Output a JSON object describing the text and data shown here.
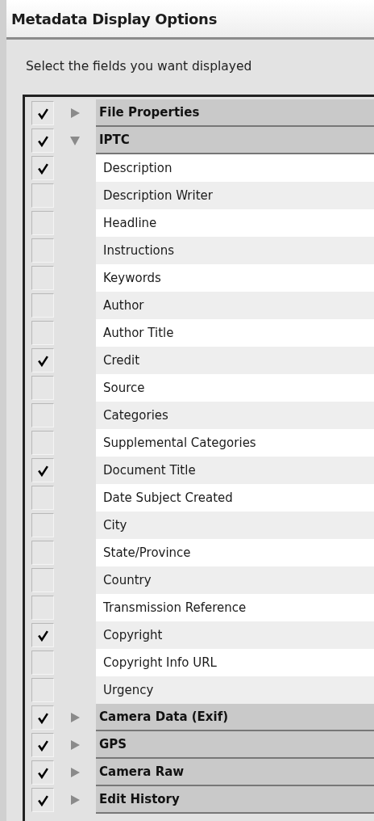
{
  "window": {
    "title": "Metadata Display Options"
  },
  "instruction": "Select the fields you want displayed",
  "groups": [
    {
      "label": "File Properties",
      "checked": true,
      "expanded": false
    },
    {
      "label": "IPTC",
      "checked": true,
      "expanded": true,
      "children": [
        {
          "label": "Description",
          "checked": true
        },
        {
          "label": "Description Writer",
          "checked": false
        },
        {
          "label": "Headline",
          "checked": false
        },
        {
          "label": "Instructions",
          "checked": false
        },
        {
          "label": "Keywords",
          "checked": false
        },
        {
          "label": "Author",
          "checked": false
        },
        {
          "label": "Author Title",
          "checked": false
        },
        {
          "label": "Credit",
          "checked": true
        },
        {
          "label": "Source",
          "checked": false
        },
        {
          "label": "Categories",
          "checked": false
        },
        {
          "label": "Supplemental Categories",
          "checked": false
        },
        {
          "label": "Document Title",
          "checked": true
        },
        {
          "label": "Date Subject Created",
          "checked": false
        },
        {
          "label": "City",
          "checked": false
        },
        {
          "label": "State/Province",
          "checked": false
        },
        {
          "label": "Country",
          "checked": false
        },
        {
          "label": "Transmission Reference",
          "checked": false
        },
        {
          "label": "Copyright",
          "checked": true
        },
        {
          "label": "Copyright Info URL",
          "checked": false
        },
        {
          "label": "Urgency",
          "checked": false
        }
      ]
    },
    {
      "label": "Camera Data (Exif)",
      "checked": true,
      "expanded": false
    },
    {
      "label": "GPS",
      "checked": true,
      "expanded": false
    },
    {
      "label": "Camera Raw",
      "checked": true,
      "expanded": false
    },
    {
      "label": "Edit History",
      "checked": true,
      "expanded": false
    }
  ]
}
